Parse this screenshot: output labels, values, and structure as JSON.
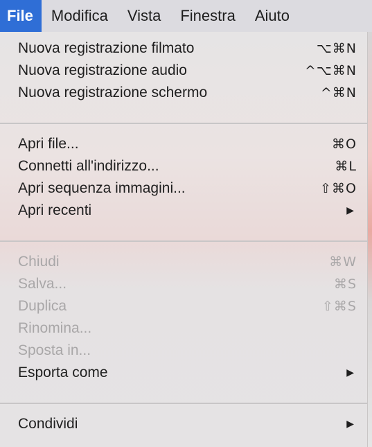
{
  "menubar": {
    "items": [
      {
        "label": "File"
      },
      {
        "label": "Modifica"
      },
      {
        "label": "Vista"
      },
      {
        "label": "Finestra"
      },
      {
        "label": "Aiuto"
      }
    ]
  },
  "dropdown": {
    "groups": [
      {
        "items": [
          {
            "label": "Nuova registrazione filmato",
            "shortcut": "⌥⌘N"
          },
          {
            "label": "Nuova registrazione audio",
            "shortcut": "^⌥⌘N"
          },
          {
            "label": "Nuova registrazione schermo",
            "shortcut": "^⌘N"
          }
        ]
      },
      {
        "items": [
          {
            "label": "Apri file...",
            "shortcut": "⌘O"
          },
          {
            "label": "Connetti all'indirizzo...",
            "shortcut": "⌘L"
          },
          {
            "label": "Apri sequenza immagini...",
            "shortcut": "⇧⌘O"
          },
          {
            "label": "Apri recenti",
            "submenu_icon": "▶"
          }
        ]
      },
      {
        "items": [
          {
            "label": "Chiudi",
            "shortcut": "⌘W",
            "disabled": true
          },
          {
            "label": "Salva...",
            "shortcut": "⌘S",
            "disabled": true
          },
          {
            "label": "Duplica",
            "shortcut": "⇧⌘S",
            "disabled": true
          },
          {
            "label": "Rinomina...",
            "disabled": true
          },
          {
            "label": "Sposta in...",
            "disabled": true
          },
          {
            "label": "Esporta come",
            "submenu_icon": "▶"
          }
        ]
      },
      {
        "items": [
          {
            "label": "Condividi",
            "submenu_icon": "▶"
          }
        ]
      }
    ]
  }
}
